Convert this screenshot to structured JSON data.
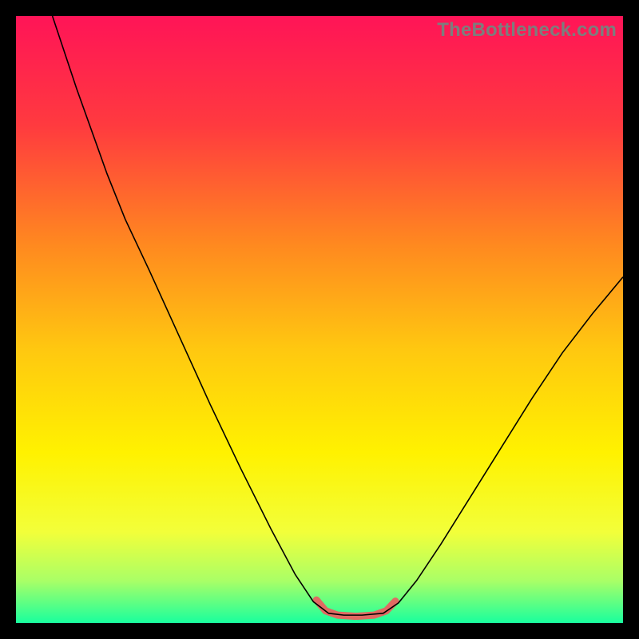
{
  "watermark": "TheBottleneck.com",
  "chart_data": {
    "type": "line",
    "title": "",
    "xlabel": "",
    "ylabel": "",
    "xlim": [
      0,
      100
    ],
    "ylim": [
      0,
      100
    ],
    "background_gradient": {
      "stops": [
        {
          "offset": 0.0,
          "color": "#ff1457"
        },
        {
          "offset": 0.18,
          "color": "#ff3a3f"
        },
        {
          "offset": 0.38,
          "color": "#ff8a1f"
        },
        {
          "offset": 0.55,
          "color": "#ffc810"
        },
        {
          "offset": 0.72,
          "color": "#fff200"
        },
        {
          "offset": 0.85,
          "color": "#f2ff3a"
        },
        {
          "offset": 0.93,
          "color": "#aaff66"
        },
        {
          "offset": 1.0,
          "color": "#19ff9e"
        }
      ]
    },
    "series": [
      {
        "name": "bottleneck-curve",
        "color": "#000000",
        "width": 1.6,
        "points": [
          {
            "x": 6.0,
            "y": 100.0
          },
          {
            "x": 10.0,
            "y": 88.0
          },
          {
            "x": 15.0,
            "y": 74.0
          },
          {
            "x": 18.0,
            "y": 66.5
          },
          {
            "x": 22.0,
            "y": 58.0
          },
          {
            "x": 27.0,
            "y": 47.0
          },
          {
            "x": 32.0,
            "y": 36.0
          },
          {
            "x": 37.0,
            "y": 25.5
          },
          {
            "x": 42.0,
            "y": 15.5
          },
          {
            "x": 46.0,
            "y": 8.0
          },
          {
            "x": 49.0,
            "y": 3.5
          },
          {
            "x": 51.5,
            "y": 1.6
          },
          {
            "x": 54.0,
            "y": 1.3
          },
          {
            "x": 57.0,
            "y": 1.3
          },
          {
            "x": 60.5,
            "y": 1.6
          },
          {
            "x": 63.0,
            "y": 3.3
          },
          {
            "x": 66.0,
            "y": 7.0
          },
          {
            "x": 70.0,
            "y": 13.0
          },
          {
            "x": 75.0,
            "y": 21.0
          },
          {
            "x": 80.0,
            "y": 29.0
          },
          {
            "x": 85.0,
            "y": 37.0
          },
          {
            "x": 90.0,
            "y": 44.5
          },
          {
            "x": 95.0,
            "y": 51.0
          },
          {
            "x": 100.0,
            "y": 57.0
          }
        ]
      },
      {
        "name": "optimal-zone-marker",
        "color": "#e06a62",
        "width": 9,
        "linecap": "round",
        "points": [
          {
            "x": 49.5,
            "y": 3.8
          },
          {
            "x": 51.0,
            "y": 2.0
          },
          {
            "x": 53.0,
            "y": 1.3
          },
          {
            "x": 56.0,
            "y": 1.1
          },
          {
            "x": 59.0,
            "y": 1.3
          },
          {
            "x": 61.0,
            "y": 2.0
          },
          {
            "x": 62.5,
            "y": 3.6
          }
        ]
      }
    ]
  }
}
